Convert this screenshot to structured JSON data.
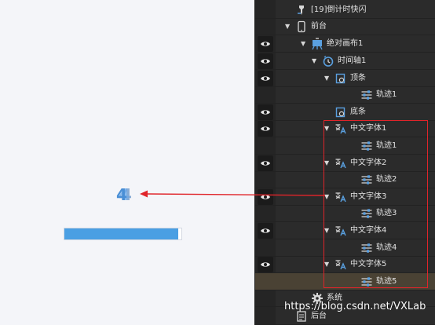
{
  "canvas": {
    "digit": "4",
    "progress_fraction": 0.97,
    "accent_color": "#4a9fe3"
  },
  "layers": [
    {
      "label": "[19]倒计时快闪",
      "icon": "pin-icon",
      "depth": 0,
      "caret": false,
      "eye": false,
      "selected": false
    },
    {
      "label": "前台",
      "icon": "phone-icon",
      "depth": 0,
      "caret": true,
      "eye": false,
      "selected": false
    },
    {
      "label": "绝对画布1",
      "icon": "canvas-icon",
      "depth": 1,
      "caret": true,
      "eye": true,
      "selected": false
    },
    {
      "label": "时间轴1",
      "icon": "timeline-icon",
      "depth": 2,
      "caret": true,
      "eye": true,
      "selected": false
    },
    {
      "label": "顶条",
      "icon": "shape-icon",
      "depth": 3,
      "caret": true,
      "eye": true,
      "selected": false
    },
    {
      "label": "轨迹1",
      "icon": "track-icon",
      "depth": 4,
      "caret": false,
      "eye": false,
      "selected": false
    },
    {
      "label": "底条",
      "icon": "shape-icon",
      "depth": 3,
      "caret": false,
      "eye": true,
      "selected": false
    },
    {
      "label": "中文字体1",
      "icon": "text-font-icon",
      "depth": 3,
      "caret": true,
      "eye": true,
      "selected": false
    },
    {
      "label": "轨迹1",
      "icon": "track-icon",
      "depth": 4,
      "caret": false,
      "eye": false,
      "selected": false
    },
    {
      "label": "中文字体2",
      "icon": "text-font-icon",
      "depth": 3,
      "caret": true,
      "eye": true,
      "selected": false
    },
    {
      "label": "轨迹2",
      "icon": "track-icon",
      "depth": 4,
      "caret": false,
      "eye": false,
      "selected": false
    },
    {
      "label": "中文字体3",
      "icon": "text-font-icon",
      "depth": 3,
      "caret": true,
      "eye": true,
      "selected": false
    },
    {
      "label": "轨迹3",
      "icon": "track-icon",
      "depth": 4,
      "caret": false,
      "eye": false,
      "selected": false
    },
    {
      "label": "中文字体4",
      "icon": "text-font-icon",
      "depth": 3,
      "caret": true,
      "eye": true,
      "selected": false
    },
    {
      "label": "轨迹4",
      "icon": "track-icon",
      "depth": 4,
      "caret": false,
      "eye": false,
      "selected": false
    },
    {
      "label": "中文字体5",
      "icon": "text-font-icon",
      "depth": 3,
      "caret": true,
      "eye": true,
      "selected": false
    },
    {
      "label": "轨迹5",
      "icon": "track-icon",
      "depth": 4,
      "caret": false,
      "eye": false,
      "selected": true
    },
    {
      "label": "系统",
      "icon": "gear-icon",
      "depth": 1,
      "caret": false,
      "eye": false,
      "selected": false
    },
    {
      "label": "后台",
      "icon": "doc-icon",
      "depth": 0,
      "caret": false,
      "eye": false,
      "selected": false
    }
  ],
  "watermark": "https://blog.csdn.net/VXLab",
  "colors": {
    "panel_bg": "#2b2b2b",
    "selected_row": "#4a4234",
    "icon_blue": "#5aa0e0",
    "annotation_red": "#e0242a"
  }
}
